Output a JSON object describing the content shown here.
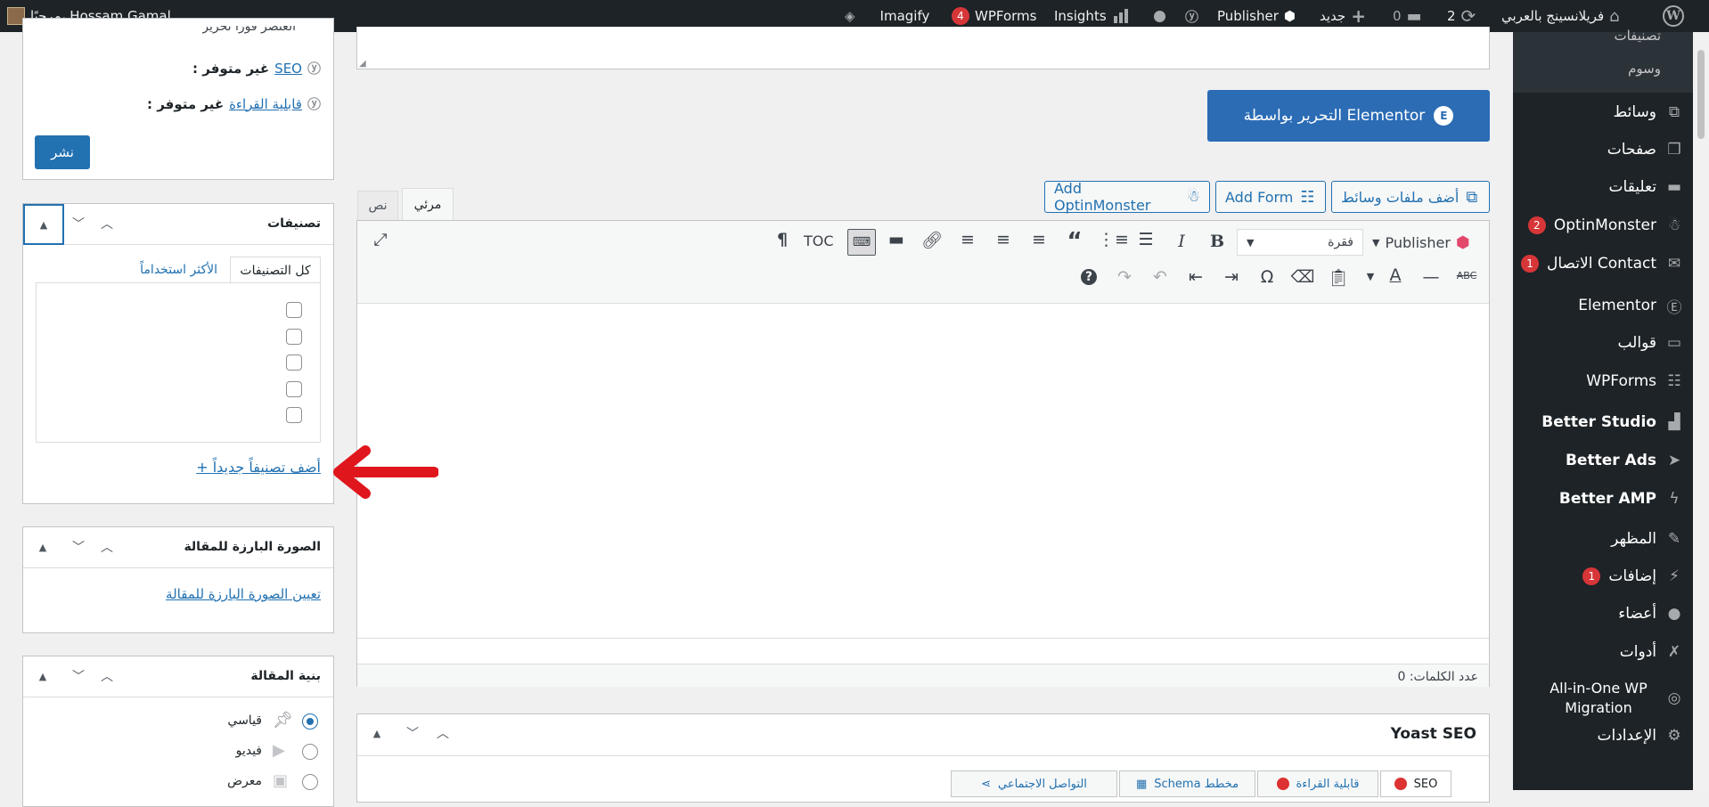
{
  "adminbar": {
    "greeting": "مرحبًا، Hossam Gamal",
    "site_name": "فريلانسينج بالعربي",
    "updates_count": "2",
    "comments_count": "0",
    "new_label": "جديد",
    "publisher": "Publisher",
    "insights": "Insights",
    "wpforms": "WPForms",
    "wpforms_count": "4",
    "imagify": "Imagify"
  },
  "sidebar": {
    "submenu": [
      "تصنيفات",
      "وسوم"
    ],
    "items": [
      {
        "label": "وسائط",
        "icon": "media-icon"
      },
      {
        "label": "صفحات",
        "icon": "pages-icon"
      },
      {
        "label": "تعليقات",
        "icon": "comments-icon"
      },
      {
        "label": "OptinMonster",
        "icon": "optinmonster-icon",
        "badge": "2"
      },
      {
        "label": "الاتصال Contact",
        "icon": "mail-icon",
        "badge": "1"
      },
      {
        "label": "Elementor",
        "icon": "elementor-icon"
      },
      {
        "label": "قوالب",
        "icon": "folder-icon"
      },
      {
        "label": "WPForms",
        "icon": "wpforms-icon"
      },
      {
        "label": "Better Studio",
        "icon": "betterstudio-icon"
      },
      {
        "label": "Better Ads",
        "icon": "betterads-icon"
      },
      {
        "label": "Better AMP",
        "icon": "bolt-icon"
      },
      {
        "label": "المظهر",
        "icon": "brush-icon"
      },
      {
        "label": "إضافات",
        "icon": "plugin-icon",
        "badge": "1"
      },
      {
        "label": "أعضاء",
        "icon": "users-icon"
      },
      {
        "label": "أدوات",
        "icon": "tools-icon"
      },
      {
        "label": "All-in-One WP Migration",
        "icon": "migration-icon"
      },
      {
        "label": "الإعدادات",
        "icon": "settings-icon"
      }
    ]
  },
  "editor": {
    "elementor_button": "التحرير بواسطة Elementor",
    "add_media": "أضف ملفات وسائط",
    "add_form": "Add Form",
    "add_optinmonster": "Add OptinMonster",
    "tab_visual": "مرئي",
    "tab_text": "نص",
    "format_select": "فقرة",
    "publisher_button": "Publisher",
    "toc": "TOC",
    "word_count": "عدد الكلمات: 0"
  },
  "yoast": {
    "title": "Yoast SEO",
    "tabs": [
      "SEO",
      "قابلية القراءة",
      "Schema مخطط",
      "التواصل الاجتماعي"
    ]
  },
  "publish_box": {
    "partial_top": "العنصر فورًا تحرير",
    "seo_label": "SEO",
    "seo_value": ": غير متوفر",
    "readability_label": "قابلية القراءة",
    "readability_value": ": غير متوفر",
    "publish_button": "نشر"
  },
  "categories_box": {
    "title": "تصنيفات",
    "tab_all": "كل التصنيفات",
    "tab_popular": "الأكثر استخداماً",
    "add_new": "+ أضف تصنيفاً جديداً"
  },
  "featured_box": {
    "title": "الصورة البارزة للمقالة",
    "set_link": "تعيين الصورة البارزة للمقالة"
  },
  "format_box": {
    "title": "بنية المقالة",
    "options": [
      "قياسي",
      "فيديو",
      "معرض"
    ]
  },
  "colors": {
    "adminbar": "#1d2327",
    "accent": "#2271b1",
    "elementor_button": "#2b6cb5",
    "badge": "#d63638",
    "arrow": "#e0161d"
  }
}
